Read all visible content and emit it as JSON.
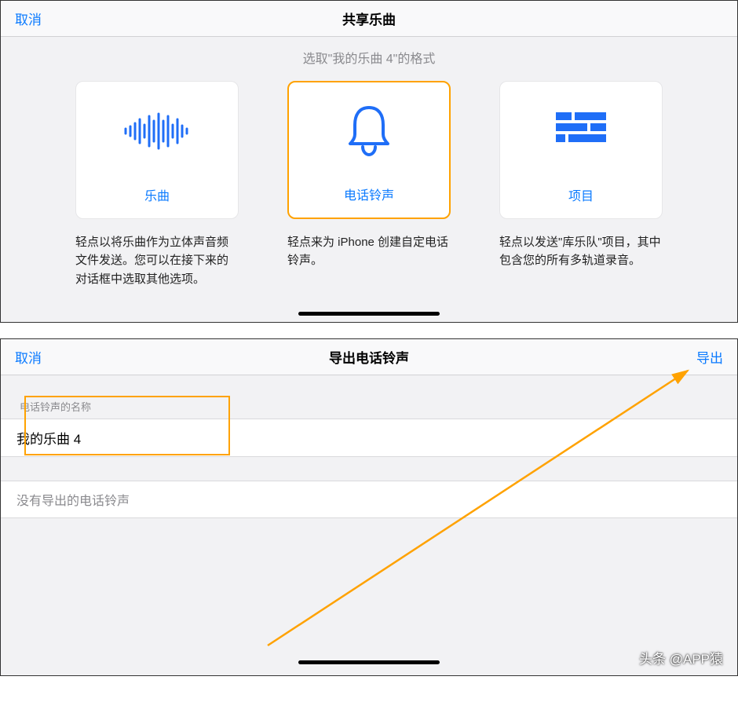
{
  "panel1": {
    "cancel": "取消",
    "title": "共享乐曲",
    "subtitle": "选取\"我的乐曲 4\"的格式",
    "cards": [
      {
        "label": "乐曲",
        "desc": "轻点以将乐曲作为立体声音频文件发送。您可以在接下来的对话框中选取其他选项。"
      },
      {
        "label": "电话铃声",
        "desc": "轻点来为 iPhone 创建自定电话铃声。"
      },
      {
        "label": "项目",
        "desc": "轻点以发送\"库乐队\"项目，其中包含您的所有多轨道录音。"
      }
    ]
  },
  "panel2": {
    "cancel": "取消",
    "title": "导出电话铃声",
    "export": "导出",
    "group_label": "电话铃声的名称",
    "name_value": "我的乐曲 4",
    "empty_msg": "没有导出的电话铃声"
  },
  "watermark": "头条 @APP猿"
}
